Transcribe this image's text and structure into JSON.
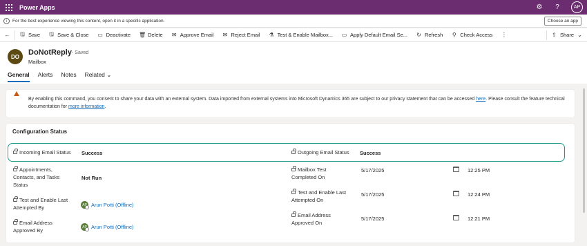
{
  "app": {
    "title": "Power Apps",
    "user_initials": "AP"
  },
  "infobar": {
    "message": "For the best experience viewing this content, open it in a specific application.",
    "button": "Choose an app"
  },
  "commands": {
    "save": "Save",
    "save_close": "Save & Close",
    "deactivate": "Deactivate",
    "delete": "Delete",
    "approve_email": "Approve Email",
    "reject_email": "Reject Email",
    "test_enable": "Test & Enable Mailbox...",
    "apply_default": "Apply Default Email Se...",
    "refresh": "Refresh",
    "check_access": "Check Access",
    "share": "Share"
  },
  "record": {
    "initials": "DO",
    "name": "DoNotReply",
    "saved": "- Saved",
    "type": "Mailbox"
  },
  "tabs": [
    "General",
    "Alerts",
    "Notes",
    "Related"
  ],
  "notice": {
    "text_before": "By enabling this command, you consent to share your data with an external system. Data imported from external systems into Microsoft Dynamics 365 are subject to our privacy statement that can be accessed ",
    "link1": "here",
    "text_middle": ". Please consult the feature technical documentation for ",
    "link2": "more information",
    "text_after": "."
  },
  "config": {
    "title": "Configuration Status",
    "incoming_label": "Incoming Email Status",
    "incoming_value": "Success",
    "outgoing_label": "Outgoing Email Status",
    "outgoing_value": "Success",
    "appointments_label": "Appointments, Contacts, and Tasks Status",
    "appointments_value": "Not Run",
    "mailbox_test_label": "Mailbox Test Completed On",
    "mailbox_test_date": "5/17/2025",
    "mailbox_test_time": "12:25 PM",
    "test_enable_by_label": "Test and Enable Last Attempted By",
    "test_enable_by_avatar": "AP",
    "test_enable_by_value": "Arun Potti (Offline)",
    "test_enable_on_label": "Test and Enable Last Attempted On",
    "test_enable_on_date": "5/17/2025",
    "test_enable_on_time": "12:24 PM",
    "approved_by_label": "Email Address Approved By",
    "approved_by_avatar": "AP",
    "approved_by_value": "Arun Potti (Offline)",
    "approved_on_label": "Email Address Approved On",
    "approved_on_date": "5/17/2025",
    "approved_on_time": "12:21 PM"
  },
  "icons": {
    "waffle": "waffle-icon",
    "settings": "gear-icon",
    "help": "help-icon",
    "back": "back-arrow-icon",
    "lock": "lock-icon",
    "calendar": "calendar-icon",
    "warning": "warning-icon"
  }
}
